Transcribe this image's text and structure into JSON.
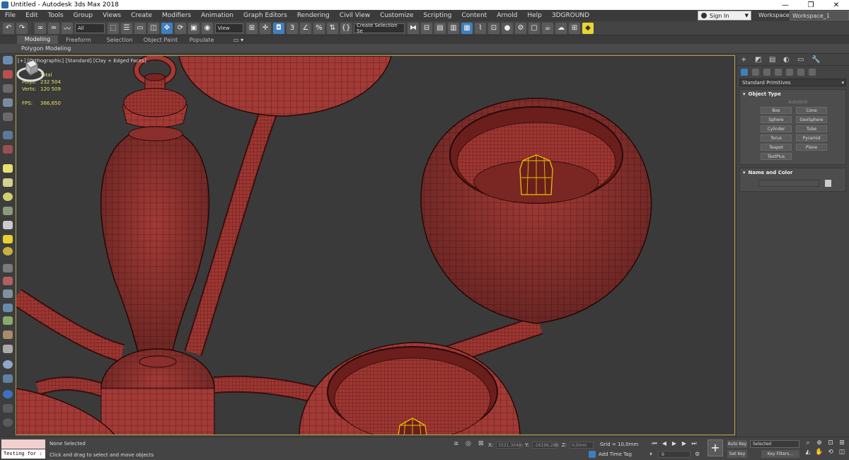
{
  "window": {
    "title": "Untitled - Autodesk 3ds Max 2018",
    "minimize": "—",
    "maximize": "❐",
    "close": "✕"
  },
  "menu": {
    "items": [
      "File",
      "Edit",
      "Tools",
      "Group",
      "Views",
      "Create",
      "Modifiers",
      "Animation",
      "Graph Editors",
      "Rendering",
      "Civil View",
      "Customize",
      "Scripting",
      "Content",
      "Arnold",
      "Help",
      "3DGROUND"
    ],
    "signin": "Sign In",
    "workspaces_label": "Workspaces:",
    "workspace_value": "Workspace_1"
  },
  "toolbar": {
    "selection_filter": "All",
    "ref_coord": "View",
    "named_selection": "Create Selection Se",
    "snap_value": "3"
  },
  "ribbon": {
    "tabs": [
      "Modeling",
      "Freeform",
      "Selection",
      "Object Paint",
      "Populate"
    ],
    "subtitle": "Polygon Modeling"
  },
  "viewport": {
    "label": "[+] [Orthographic] [Standard] [Clay + Edged Faces]",
    "stats": {
      "total_label": "Total",
      "polys_label": "Polys:",
      "polys": "232 504",
      "verts_label": "Verts:",
      "verts": "120 509",
      "fps_label": "FPS:",
      "fps": "366,650"
    },
    "colors": {
      "mesh": "#a23a36",
      "wire": "#3a0e0c",
      "selection": "#f0c000",
      "background": "#3a3a3a"
    }
  },
  "command_panel": {
    "category_dropdown": "Standard Primitives",
    "object_type_title": "Object Type",
    "autogrid": "AutoGrid",
    "buttons": [
      "Box",
      "Cone",
      "Sphere",
      "GeoSphere",
      "Cylinder",
      "Tube",
      "Torus",
      "Pyramid",
      "Teapot",
      "Plane",
      "TextPlus"
    ],
    "name_color_title": "Name and Color"
  },
  "status": {
    "maxscript_text": "Testing for :",
    "selection_text": "None Selected",
    "prompt_text": "Click and drag to select and move objects",
    "x_label": "X:",
    "x": "3531,304m",
    "y_label": "Y:",
    "y": "-16196,288",
    "z_label": "Z:",
    "z": "0,0mm",
    "grid": "Grid = 10,0mm",
    "add_time_tag": "Add Time Tag",
    "frame": "0",
    "auto_key": "Auto Key",
    "set_key": "Set Key",
    "selected_dropdown": "Selected",
    "key_filters": "Key Filters..."
  }
}
